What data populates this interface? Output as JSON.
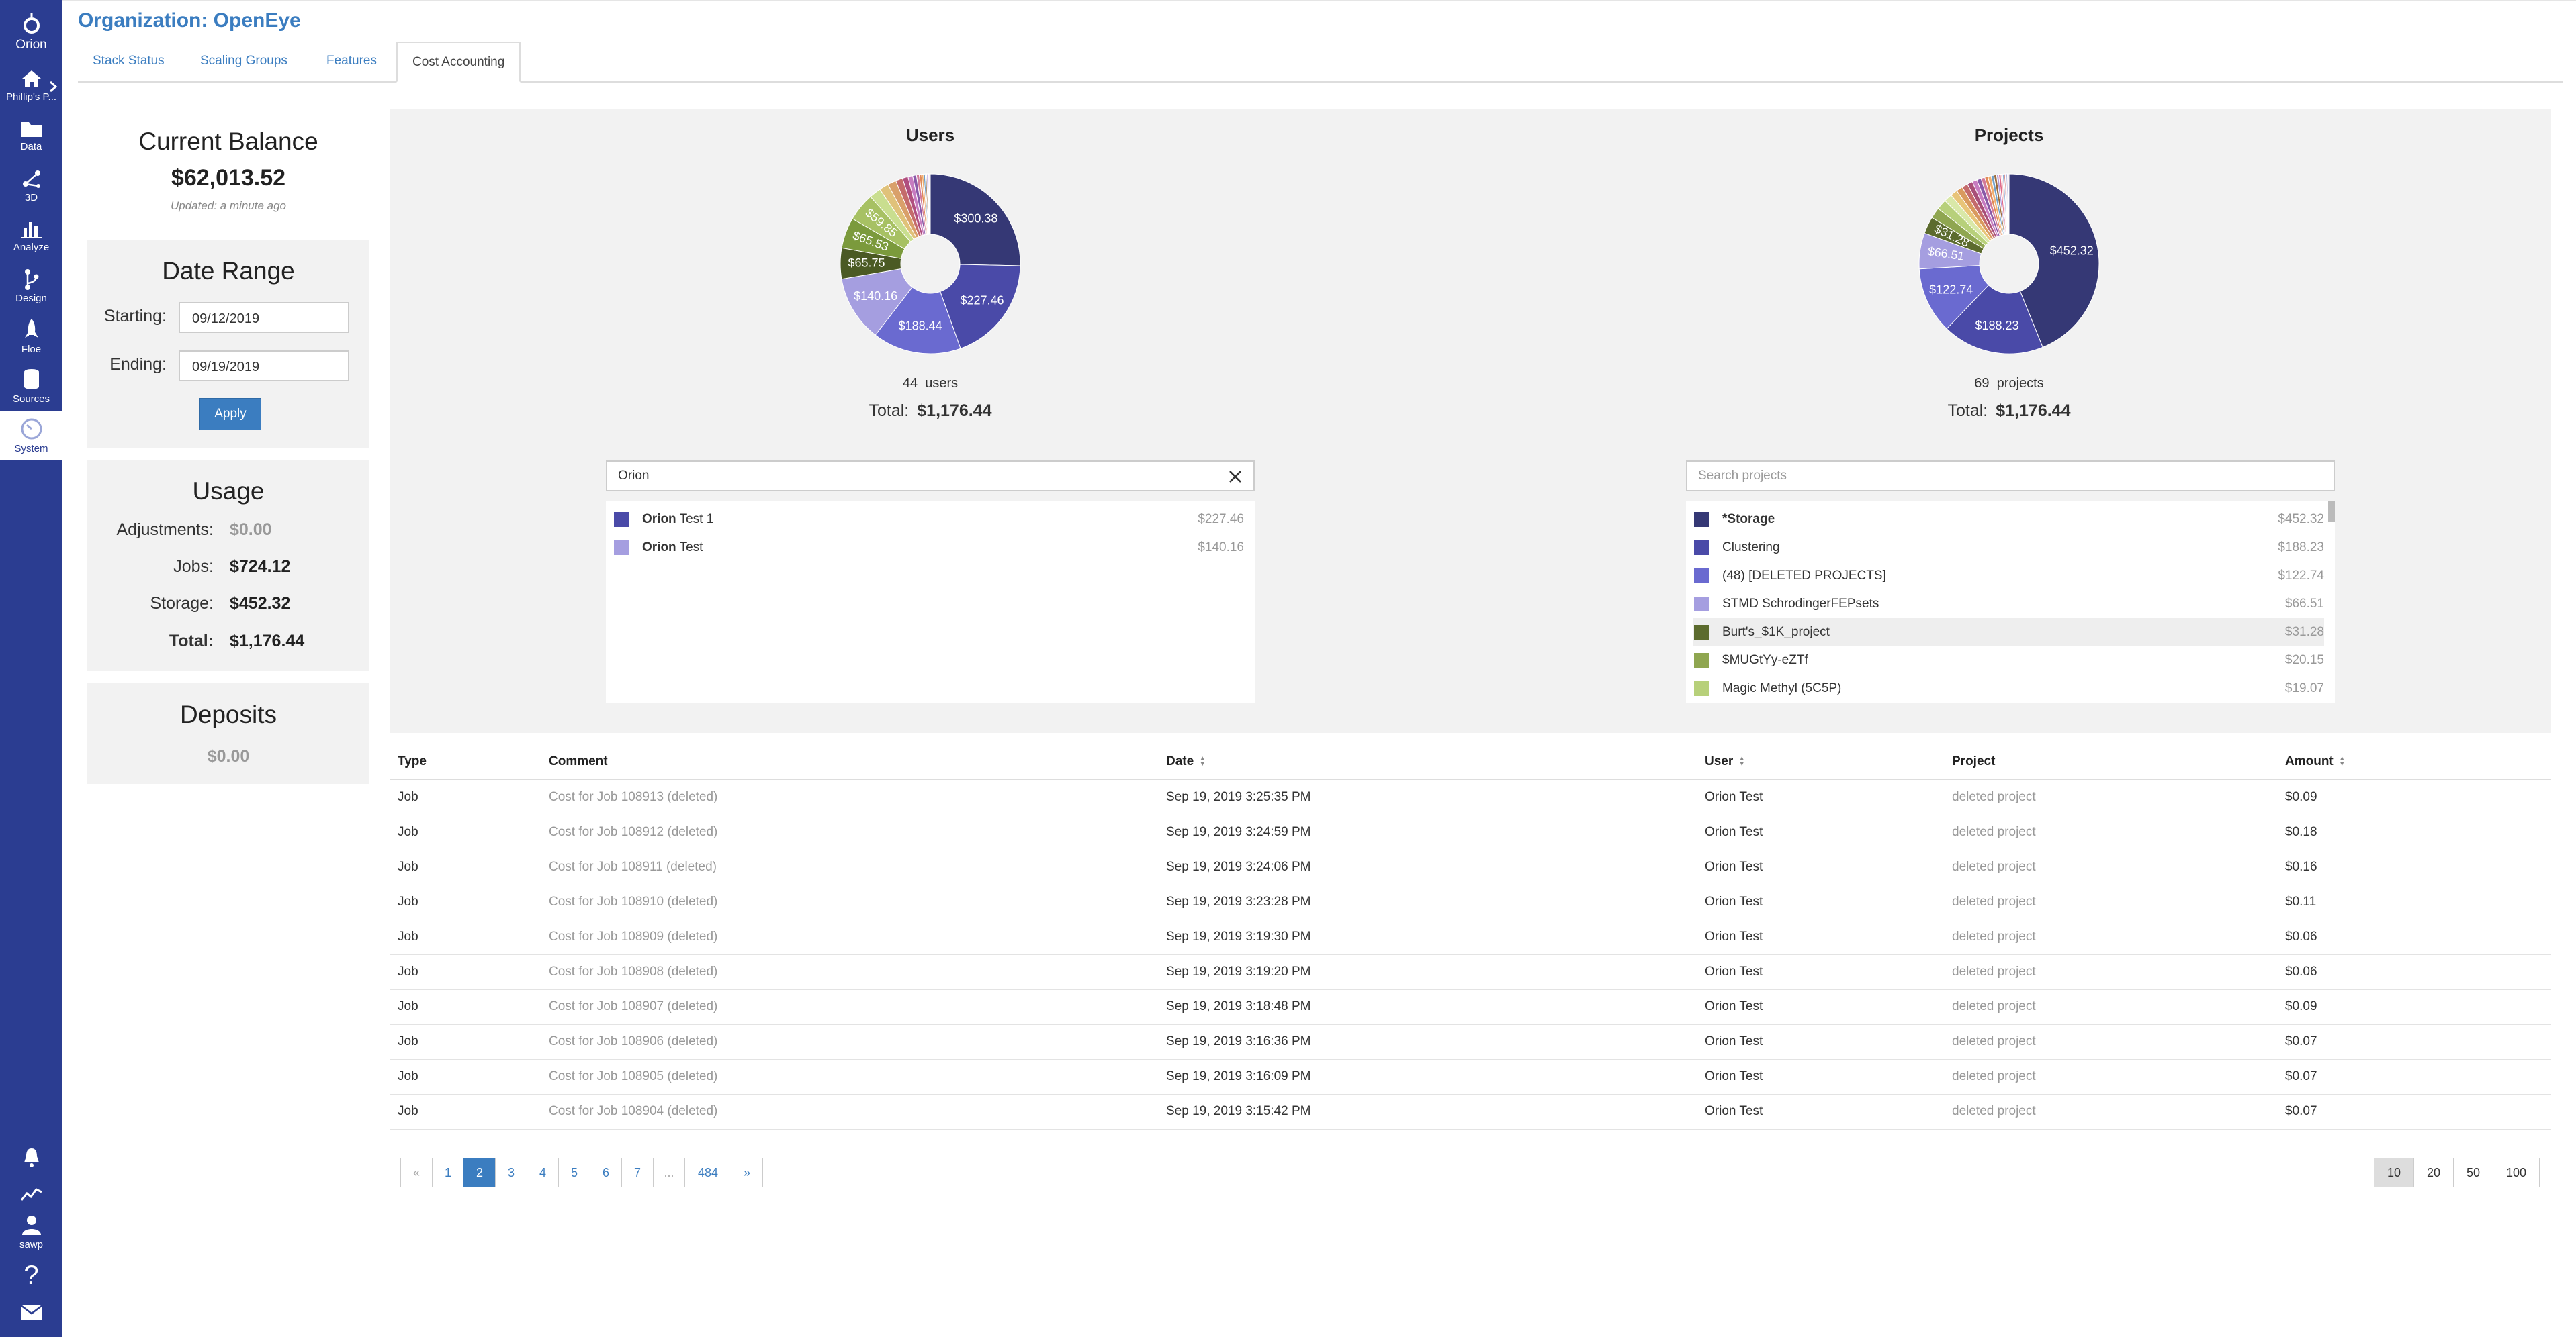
{
  "nav": {
    "logo_label": "Orion",
    "items": [
      {
        "label": "Phillip's P...",
        "icon": "home-icon"
      },
      {
        "label": "Data",
        "icon": "folder-icon"
      },
      {
        "label": "3D",
        "icon": "molecule-icon"
      },
      {
        "label": "Analyze",
        "icon": "bar-chart-icon"
      },
      {
        "label": "Design",
        "icon": "branch-icon"
      },
      {
        "label": "Floe",
        "icon": "rocket-icon"
      },
      {
        "label": "Sources",
        "icon": "database-icon"
      },
      {
        "label": "System",
        "icon": "gauge-icon"
      }
    ],
    "bottom": [
      {
        "label": "",
        "icon": "bell-icon"
      },
      {
        "label": "",
        "icon": "activity-icon"
      },
      {
        "label": "sawp",
        "icon": "user-icon"
      },
      {
        "label": "?",
        "icon": "help-icon"
      },
      {
        "label": "",
        "icon": "mail-icon"
      }
    ]
  },
  "header": {
    "title": "Organization: OpenEye",
    "tabs": [
      "Stack Status",
      "Scaling Groups",
      "Features",
      "Cost Accounting"
    ],
    "active_tab": "Cost Accounting"
  },
  "balance": {
    "title": "Current Balance",
    "value": "$62,013.52",
    "updated": "Updated: a minute ago"
  },
  "date_range": {
    "title": "Date Range",
    "starting_label": "Starting:",
    "starting_value": "09/12/2019",
    "ending_label": "Ending:",
    "ending_value": "09/19/2019",
    "apply_label": "Apply"
  },
  "usage": {
    "title": "Usage",
    "rows": [
      {
        "label": "Adjustments:",
        "value": "$0.00"
      },
      {
        "label": "Jobs:",
        "value": "$724.12"
      },
      {
        "label": "Storage:",
        "value": "$452.32"
      },
      {
        "label": "Total:",
        "value": "$1,176.44"
      }
    ]
  },
  "deposits": {
    "title": "Deposits",
    "value": "$0.00"
  },
  "colors": {
    "accent": "#3b7dc0",
    "nav_bg": "#2b3d91"
  },
  "users_chart": {
    "title": "Users",
    "count": "44",
    "count_unit": "users",
    "total_label": "Total:",
    "total_value": "$1,176.44",
    "search_value": "Orion",
    "list": [
      {
        "bold": "Orion",
        "rest": " Test 1",
        "value": "$227.46",
        "color": "#4a4aa8"
      },
      {
        "bold": "Orion",
        "rest": " Test",
        "value": "$140.16",
        "color": "#a59ee0"
      }
    ]
  },
  "projects_chart": {
    "title": "Projects",
    "count": "69",
    "count_unit": "projects",
    "total_label": "Total:",
    "total_value": "$1,176.44",
    "search_placeholder": "Search projects",
    "list": [
      {
        "name": "*Storage",
        "value": "$452.32",
        "color": "#353875",
        "bold": true
      },
      {
        "name": "Clustering",
        "value": "$188.23",
        "color": "#4a4aa8"
      },
      {
        "name": "(48) [DELETED PROJECTS]",
        "value": "$122.74",
        "color": "#6a6ad0"
      },
      {
        "name": "STMD SchrodingerFEPsets",
        "value": "$66.51",
        "color": "#a59ee0"
      },
      {
        "name": "Burt's_$1K_project",
        "value": "$31.28",
        "color": "#5c6b2e",
        "highlight": true
      },
      {
        "name": "$MUGtYy-eZTf",
        "value": "$20.15",
        "color": "#8fa650"
      },
      {
        "name": "Magic Methyl (5C5P)",
        "value": "$19.07",
        "color": "#b7d07a"
      }
    ]
  },
  "chart_data": [
    {
      "type": "pie",
      "title": "Users",
      "values": [
        300.38,
        227.46,
        188.44,
        140.16,
        65.75,
        65.53,
        59.85,
        25,
        20,
        18,
        15,
        12,
        10,
        8,
        6,
        5,
        4,
        3.5,
        3,
        2.5,
        2,
        1.8,
        1.5
      ],
      "labels": [
        "$300.38",
        "$227.46",
        "$188.44",
        "$140.16",
        "$65.75",
        "$65.53",
        "$59.85"
      ],
      "colors": [
        "#353875",
        "#4a4aa8",
        "#6a6ad0",
        "#a59ee0",
        "#4b5a24",
        "#7b9a3c",
        "#a7c163",
        "#c9de8f",
        "#e0c27a",
        "#d9a06a",
        "#c46b6b",
        "#b04f7f",
        "#c77cc0",
        "#8a5aa8",
        "#d27a9a",
        "#e08a5a",
        "#f0b070",
        "#6fa0c8",
        "#9c6b3a",
        "#b39ad9",
        "#d9b3e0",
        "#f2c2c2",
        "#8fb0d9"
      ]
    },
    {
      "type": "pie",
      "title": "Projects",
      "values": [
        452.32,
        188.23,
        122.74,
        66.51,
        31.28,
        20.15,
        19.07,
        15,
        13,
        12,
        11,
        10,
        9,
        8,
        7,
        6,
        6,
        5,
        5,
        4,
        4,
        3,
        3,
        2,
        2,
        2,
        1.5,
        1.5
      ],
      "labels": [
        "$452.32",
        "$188.23",
        "$122.74",
        "$66.51",
        "$31.28"
      ],
      "colors": [
        "#353875",
        "#4a4aa8",
        "#6a6ad0",
        "#a59ee0",
        "#5c6b2e",
        "#8fa650",
        "#b7d07a",
        "#d9e8a8",
        "#e8c478",
        "#d99a5e",
        "#c46b6b",
        "#a84f78",
        "#c77cc0",
        "#8a5aa8",
        "#d27a9a",
        "#e08a5a",
        "#f0b070",
        "#6fa0c8",
        "#9c6b3a",
        "#b39ad9",
        "#e06a8a",
        "#f2c2c2",
        "#8fb0d9",
        "#b84040",
        "#d0a0d0",
        "#7070c0",
        "#c0c070",
        "#e0a0b0"
      ]
    }
  ],
  "table": {
    "headers": [
      "Type",
      "Comment",
      "Date",
      "User",
      "Project",
      "Amount"
    ],
    "rows": [
      [
        "Job",
        "Cost for Job 108913 (deleted)",
        "Sep 19, 2019 3:25:35 PM",
        "Orion Test",
        "deleted project",
        "$0.09"
      ],
      [
        "Job",
        "Cost for Job 108912 (deleted)",
        "Sep 19, 2019 3:24:59 PM",
        "Orion Test",
        "deleted project",
        "$0.18"
      ],
      [
        "Job",
        "Cost for Job 108911 (deleted)",
        "Sep 19, 2019 3:24:06 PM",
        "Orion Test",
        "deleted project",
        "$0.16"
      ],
      [
        "Job",
        "Cost for Job 108910 (deleted)",
        "Sep 19, 2019 3:23:28 PM",
        "Orion Test",
        "deleted project",
        "$0.11"
      ],
      [
        "Job",
        "Cost for Job 108909 (deleted)",
        "Sep 19, 2019 3:19:30 PM",
        "Orion Test",
        "deleted project",
        "$0.06"
      ],
      [
        "Job",
        "Cost for Job 108908 (deleted)",
        "Sep 19, 2019 3:19:20 PM",
        "Orion Test",
        "deleted project",
        "$0.06"
      ],
      [
        "Job",
        "Cost for Job 108907 (deleted)",
        "Sep 19, 2019 3:18:48 PM",
        "Orion Test",
        "deleted project",
        "$0.09"
      ],
      [
        "Job",
        "Cost for Job 108906 (deleted)",
        "Sep 19, 2019 3:16:36 PM",
        "Orion Test",
        "deleted project",
        "$0.07"
      ],
      [
        "Job",
        "Cost for Job 108905 (deleted)",
        "Sep 19, 2019 3:16:09 PM",
        "Orion Test",
        "deleted project",
        "$0.07"
      ],
      [
        "Job",
        "Cost for Job 108904 (deleted)",
        "Sep 19, 2019 3:15:42 PM",
        "Orion Test",
        "deleted project",
        "$0.07"
      ]
    ]
  },
  "pagination": {
    "pages": [
      "«",
      "1",
      "2",
      "3",
      "4",
      "5",
      "6",
      "7",
      "...",
      "484",
      "»"
    ],
    "active": "2",
    "page_sizes": [
      "10",
      "20",
      "50",
      "100"
    ],
    "active_size": "10"
  }
}
